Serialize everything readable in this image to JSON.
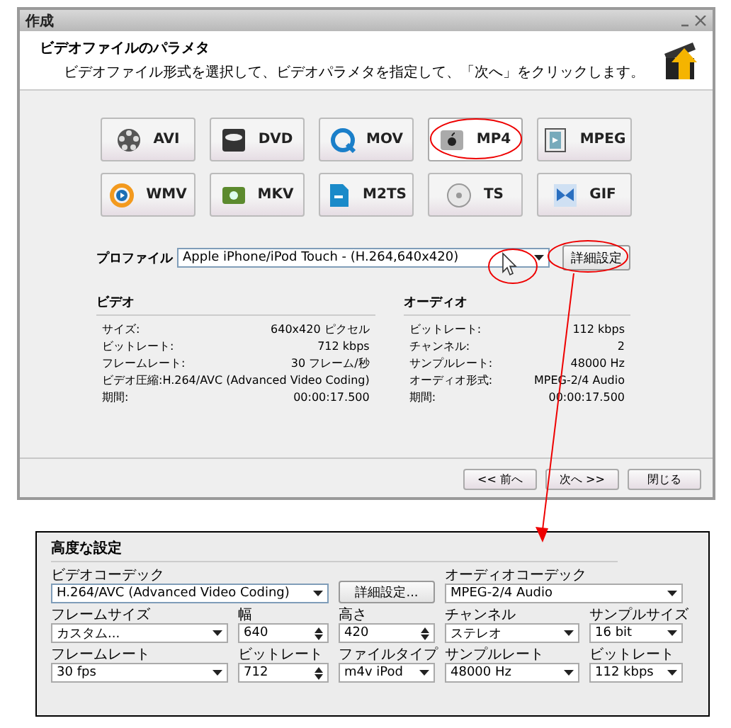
{
  "window": {
    "title": "作成"
  },
  "header": {
    "title": "ビデオファイルのパラメタ",
    "description": "ビデオファイル形式を選択して、ビデオパラメタを指定して、「次へ」をクリックします。"
  },
  "formats": [
    {
      "label": "AVI",
      "kind": "avi",
      "selected": false
    },
    {
      "label": "DVD",
      "kind": "dvd",
      "selected": false
    },
    {
      "label": "MOV",
      "kind": "mov",
      "selected": false
    },
    {
      "label": "MP4",
      "kind": "mp4",
      "selected": true
    },
    {
      "label": "MPEG",
      "kind": "mpeg",
      "selected": false
    },
    {
      "label": "WMV",
      "kind": "wmv",
      "selected": false
    },
    {
      "label": "MKV",
      "kind": "mkv",
      "selected": false
    },
    {
      "label": "M2TS",
      "kind": "m2ts",
      "selected": false
    },
    {
      "label": "TS",
      "kind": "ts",
      "selected": false
    },
    {
      "label": "GIF",
      "kind": "gif",
      "selected": false
    }
  ],
  "profile": {
    "label": "プロファイル",
    "value": "Apple iPhone/iPod Touch - (H.264,640x420)",
    "button": "詳細設定"
  },
  "video": {
    "title": "ビデオ",
    "rows": [
      {
        "label": "サイズ:",
        "value": "640x420 ピクセル"
      },
      {
        "label": "ビットレート:",
        "value": "712 kbps"
      },
      {
        "label": "フレームレート:",
        "value": "30 フレーム/秒"
      },
      {
        "label": "ビデオ圧縮:",
        "value": "H.264/AVC (Advanced Video Coding)"
      },
      {
        "label": "期間:",
        "value": "00:00:17.500"
      }
    ]
  },
  "audio": {
    "title": "オーディオ",
    "rows": [
      {
        "label": "ビットレート:",
        "value": "112 kbps"
      },
      {
        "label": "チャンネル:",
        "value": "2"
      },
      {
        "label": "サンプルレート:",
        "value": "48000 Hz"
      },
      {
        "label": "オーディオ形式:",
        "value": "MPEG-2/4 Audio"
      },
      {
        "label": "期間:",
        "value": "00:00:17.500"
      }
    ]
  },
  "buttons": [
    "<< 前へ",
    "次へ >>",
    "閉じる"
  ],
  "advanced": {
    "title": "高度な設定",
    "video_codec": {
      "label": "ビデオコーデック",
      "value": "H.264/AVC (Advanced Video Coding)"
    },
    "detail_button": "詳細設定...",
    "audio_codec": {
      "label": "オーディオコーデック",
      "value": "MPEG-2/4 Audio"
    },
    "fields": [
      {
        "label": "フレームサイズ",
        "value": "カスタム...",
        "kind": "select"
      },
      {
        "label": "幅",
        "value": "640",
        "kind": "spin"
      },
      {
        "label": "高さ",
        "value": "420",
        "kind": "spin"
      },
      {
        "label": "チャンネル",
        "value": "ステレオ",
        "kind": "select"
      },
      {
        "label": "サンプルサイズ",
        "value": "16 bit",
        "kind": "select"
      },
      {
        "label": "フレームレート",
        "value": "30 fps",
        "kind": "select"
      },
      {
        "label": "ビットレート",
        "value": "712",
        "kind": "spin"
      },
      {
        "label": "ファイルタイプ",
        "value": "m4v iPod",
        "kind": "select"
      },
      {
        "label": "サンプルレート",
        "value": "48000 Hz",
        "kind": "select"
      },
      {
        "label": "ビットレート",
        "value": "112 kbps",
        "kind": "select"
      }
    ]
  }
}
